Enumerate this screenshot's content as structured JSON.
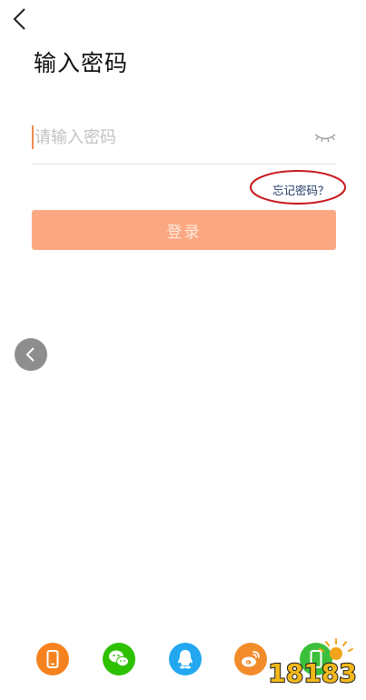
{
  "header": {
    "back_icon": "chevron-left-icon",
    "title": "输入密码"
  },
  "password": {
    "placeholder": "请输入密码",
    "value": "",
    "toggle_icon": "eye-closed-icon"
  },
  "forgot_link": "忘记密码？",
  "login_button": "登录",
  "floating_back_icon": "chevron-left-icon",
  "social_login": [
    {
      "name": "phone",
      "icon": "phone-icon",
      "color": "#f5821f"
    },
    {
      "name": "wechat",
      "icon": "wechat-icon",
      "color": "#2dc100"
    },
    {
      "name": "qq",
      "icon": "qq-icon",
      "color": "#22a7f0"
    },
    {
      "name": "weibo",
      "icon": "weibo-icon",
      "color": "#f28c2a"
    },
    {
      "name": "other",
      "icon": "phone-green-icon",
      "color": "#3cbf3c"
    }
  ],
  "watermark": "18183",
  "colors": {
    "accent": "#fba882",
    "link": "#1e3a66",
    "caret": "#f08a52",
    "annotation": "#c8191d"
  }
}
